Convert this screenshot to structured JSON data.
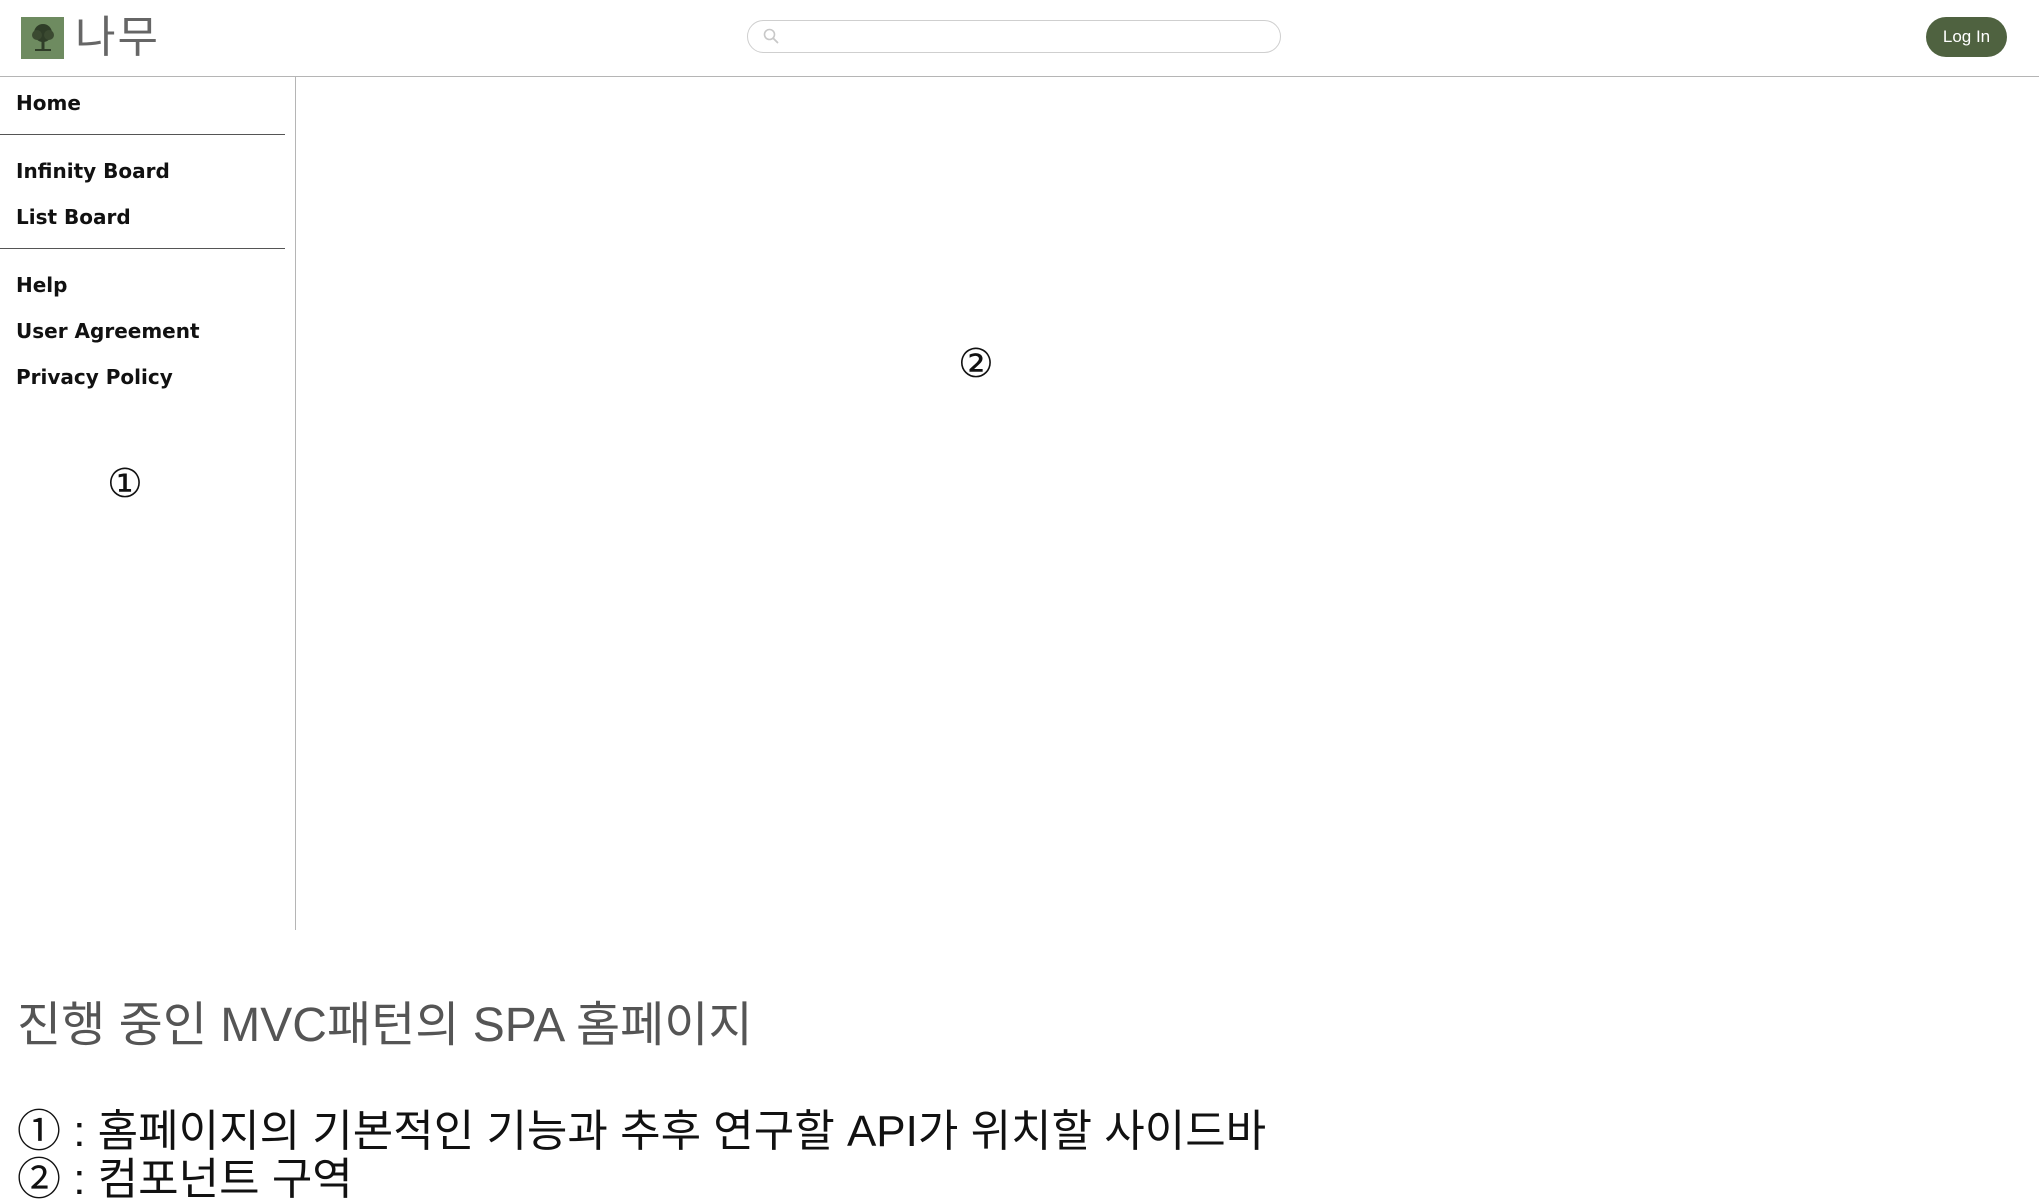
{
  "header": {
    "logo_text": "나무",
    "logo_icon": "tree-icon",
    "search": {
      "placeholder": "",
      "value": "",
      "icon": "search-icon"
    },
    "login_label": "Log In",
    "accent_color": "#4f6240"
  },
  "sidebar": {
    "groups": [
      {
        "items": [
          {
            "label": "Home"
          }
        ]
      },
      {
        "items": [
          {
            "label": "Infinity Board"
          },
          {
            "label": "List Board"
          }
        ]
      },
      {
        "items": [
          {
            "label": "Help"
          },
          {
            "label": "User Agreement"
          },
          {
            "label": "Privacy Policy"
          }
        ]
      }
    ],
    "marker": "①"
  },
  "main": {
    "marker": "②"
  },
  "caption": {
    "title": "진행 중인 MVC패턴의 SPA 홈페이지",
    "lines": [
      "① : 홈페이지의 기본적인 기능과 추후 연구할 API가 위치할 사이드바",
      "② : 컴포넌트 구역"
    ]
  }
}
